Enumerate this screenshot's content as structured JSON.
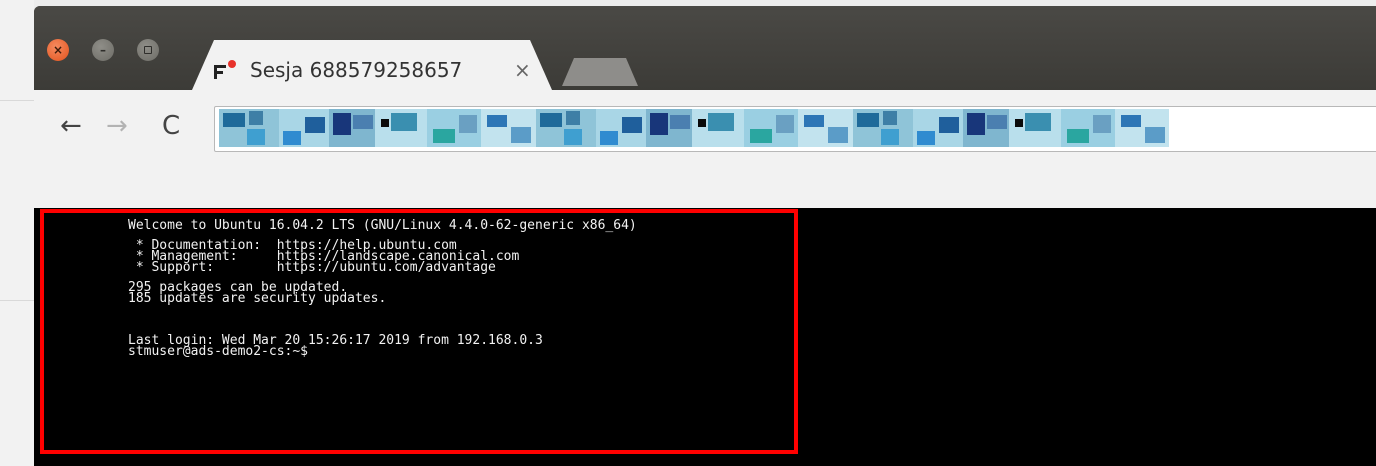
{
  "browser": {
    "tab": {
      "title": "Sesja 688579258657",
      "close_glyph": "×",
      "favicon": "brand-logo-icon"
    },
    "nav": {
      "back": "←",
      "forward": "→",
      "reload": "C"
    },
    "window_controls": {
      "close": "×",
      "minimize": "–"
    }
  },
  "terminal": {
    "lines": [
      "Welcome to Ubuntu 16.04.2 LTS (GNU/Linux 4.4.0-62-generic x86_64)",
      "",
      " * Documentation:  https://help.ubuntu.com",
      " * Management:     https://landscape.canonical.com",
      " * Support:        https://ubuntu.com/advantage",
      "",
      "295 packages can be updated.",
      "185 updates are security updates.",
      "",
      "",
      "Last login: Wed Mar 20 15:26:17 2019 from 192.168.0.3",
      "stmuser@ads-demo2-cs:~$"
    ]
  },
  "colors": {
    "highlight": "#ff0000",
    "terminal_bg": "#000000",
    "titlebar": "#3c3b37",
    "favicon_dot": "#e8322b"
  }
}
